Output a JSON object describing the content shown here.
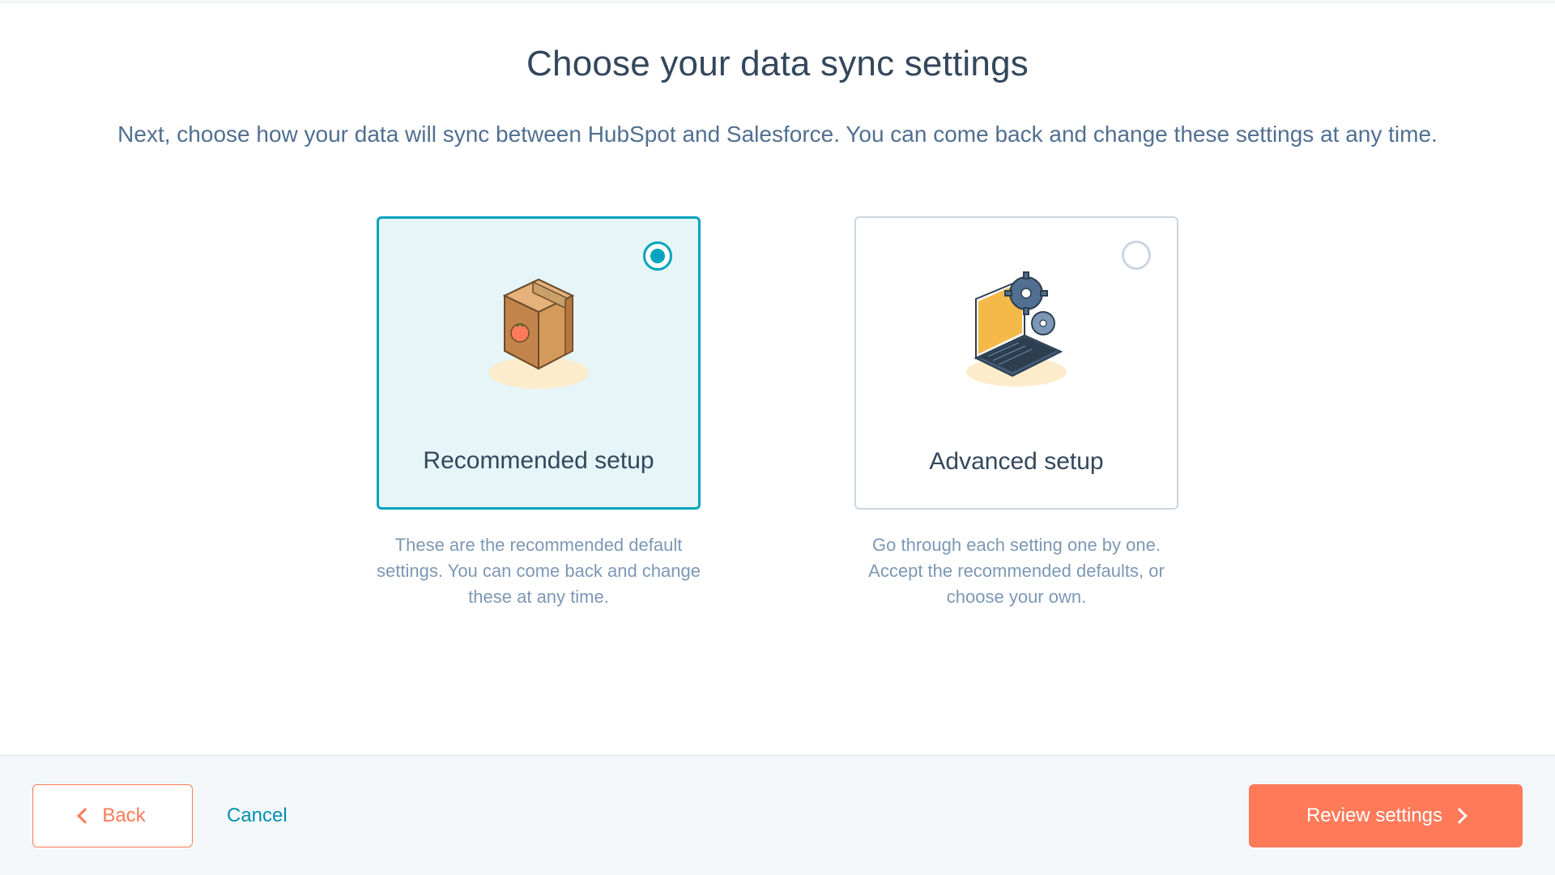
{
  "header": {
    "title": "Choose your data sync settings",
    "subtitle": "Next, choose how your data will sync between HubSpot and Salesforce. You can come back and change these settings at any time."
  },
  "options": {
    "recommended": {
      "title": "Recommended setup",
      "description": "These are the recommended default settings. You can come back and change these at any time.",
      "selected": true
    },
    "advanced": {
      "title": "Advanced setup",
      "description": "Go through each setting one by one. Accept the recommended defaults, or choose your own.",
      "selected": false
    }
  },
  "footer": {
    "back": "Back",
    "cancel": "Cancel",
    "review": "Review settings"
  },
  "colors": {
    "accent_teal": "#00a4bd",
    "accent_orange": "#ff7a59",
    "text_primary": "#33475b",
    "text_muted": "#7c98b6"
  }
}
